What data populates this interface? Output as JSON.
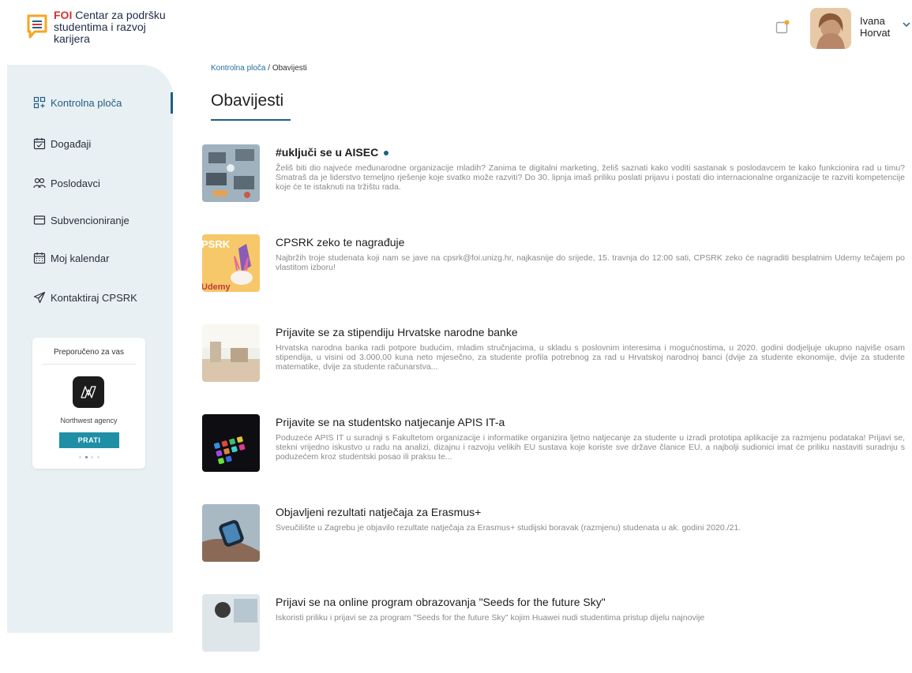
{
  "header": {
    "logo_brand": "FOI",
    "logo_line1": " Centar za podršku",
    "logo_line2": "studentima i razvoj karijera",
    "user_first": "Ivana",
    "user_last": "Horvat",
    "icons": [
      "chat-logo-icon",
      "notification-icon",
      "chevron-down-icon"
    ]
  },
  "sidebar": {
    "items": [
      {
        "label": "Kontrolna ploča",
        "icon": "dashboard-icon",
        "active": true
      },
      {
        "label": "Događaji",
        "icon": "calendar-check-icon"
      },
      {
        "label": "Poslodavci",
        "icon": "people-icon"
      },
      {
        "label": "Subvencioniranje",
        "icon": "card-icon"
      },
      {
        "label": "Moj kalendar",
        "icon": "calendar-icon"
      },
      {
        "label": "Kontaktiraj CPSRK",
        "icon": "send-icon"
      }
    ],
    "recommended": {
      "title": "Preporučeno za vas",
      "company": "Northwest agency",
      "button": "PRATI",
      "active_dot": 1,
      "dot_count": 4
    }
  },
  "breadcrumb": {
    "parent": "Kontrolna ploča",
    "separator": " / ",
    "current": "Obavijesti"
  },
  "page_title": "Obavijesti",
  "news": [
    {
      "title": "#uključi se u AISEC",
      "unread": true,
      "body": "Želiš biti dio najveće međunarodne organizacije mladih? Zanima te digitalni marketing, želiš saznati kako voditi sastanak s poslodavcem te kako funkcionira rad u timu? Smatraš da je liderstvo temeljno rješenje koje svatko može razviti? Do 30. lipnja imaš priliku poslati prijavu i postati dio internacionalne organizacije te razviti kompetencije koje će te istaknuti na tržištu rada."
    },
    {
      "title": "CPSRK zeko te nagrađuje",
      "unread": false,
      "thumb_text1": "PSRK",
      "thumb_text2": "Udemy",
      "body": "Najbržih troje studenata koji nam se jave na cpsrk@foi.unizg.hr, najkasnije do srijede, 15. travnja do 12:00 sati, CPSRK zeko će nagraditi besplatnim Udemy tečajem po vlastitom izboru!"
    },
    {
      "title": "Prijavite se za stipendiju Hrvatske narodne banke",
      "unread": false,
      "body": "Hrvatska narodna banka radi potpore budućim, mladim stručnjacima, u skladu s poslovnim interesima i mogućnostima, u 2020. godini dodjeljuje ukupno najviše osam stipendija, u visini od 3.000,00 kuna neto mjesečno, za studente profila potrebnog za rad u Hrvatskoj narodnoj banci (dvije za studente ekonomije, dvije za studente matematike, dvije za studente računarstva..."
    },
    {
      "title": "Prijavite se na studentsko natjecanje APIS IT-a",
      "unread": false,
      "body": "Poduzeće APIS IT u suradnji s Fakultetom organizacije i informatike organizira ljetno natjecanje za studente u izradi prototipa aplikacije za razmjenu podataka! Prijavi se, stekni vrijedno iskustvo u radu na analizi, dizajnu i razvoju velikih EU sustava koje koriste sve države članice EU, a najbolji sudionici imat će priliku nastaviti suradnju s poduzećem kroz studentski posao ili praksu te..."
    },
    {
      "title": "Objavljeni rezultati natječaja za Erasmus+",
      "unread": false,
      "body": "Sveučilište u Zagrebu je objavilo rezultate natječaja za Erasmus+ studijski boravak (razmjenu) studenata u ak. godini 2020./21."
    },
    {
      "title": "Prijavi se na online program obrazovanja \"Seeds for the future Sky\"",
      "unread": false,
      "body": "Iskoristi priliku i prijavi se za program \"Seeds for the future Sky\" kojim Huawei nudi studentima pristup dijelu najnovije"
    }
  ],
  "colors": {
    "accent": "#1f5f86",
    "sidebar_bg": "#e9f0f3",
    "button": "#1f8fa6",
    "logo_orange": "#f5a623",
    "logo_red": "#d6322e"
  }
}
